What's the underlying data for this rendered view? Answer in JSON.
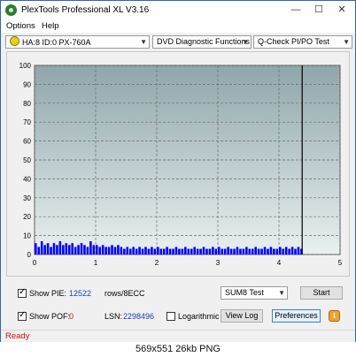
{
  "window": {
    "title": "PlexTools Professional XL V3.16",
    "minimize": "—",
    "maximize": "☐",
    "close": "✕"
  },
  "menu": {
    "options": "Options",
    "help": "Help"
  },
  "toolbar": {
    "drive": "HA:8 ID:0  PX-760A",
    "mode": "DVD Diagnostic Functions",
    "test": "Q-Check PI/PO Test"
  },
  "chart_data": {
    "type": "bar",
    "title": "",
    "xlabel": "",
    "ylabel": "",
    "xlim": [
      0,
      5
    ],
    "ylim": [
      0,
      100
    ],
    "x_ticks": [
      "0",
      "1",
      "2",
      "3",
      "4",
      "5"
    ],
    "y_ticks": [
      "0",
      "10",
      "20",
      "30",
      "40",
      "50",
      "60",
      "70",
      "80",
      "90",
      "100"
    ],
    "grid": true,
    "end_marker_x": 4.38,
    "series": [
      {
        "color": "#0000ff",
        "points": [
          [
            0.0,
            6
          ],
          [
            0.05,
            4
          ],
          [
            0.1,
            7
          ],
          [
            0.15,
            5
          ],
          [
            0.2,
            6
          ],
          [
            0.25,
            4
          ],
          [
            0.3,
            6
          ],
          [
            0.35,
            5
          ],
          [
            0.4,
            7
          ],
          [
            0.45,
            5
          ],
          [
            0.5,
            6
          ],
          [
            0.55,
            5
          ],
          [
            0.6,
            6
          ],
          [
            0.65,
            4
          ],
          [
            0.7,
            5
          ],
          [
            0.75,
            6
          ],
          [
            0.8,
            5
          ],
          [
            0.85,
            4
          ],
          [
            0.9,
            7
          ],
          [
            0.95,
            5
          ],
          [
            1.0,
            5
          ],
          [
            1.05,
            4
          ],
          [
            1.1,
            5
          ],
          [
            1.15,
            4
          ],
          [
            1.2,
            4
          ],
          [
            1.25,
            5
          ],
          [
            1.3,
            4
          ],
          [
            1.35,
            5
          ],
          [
            1.4,
            4
          ],
          [
            1.45,
            3
          ],
          [
            1.5,
            4
          ],
          [
            1.55,
            3
          ],
          [
            1.6,
            4
          ],
          [
            1.65,
            3
          ],
          [
            1.7,
            4
          ],
          [
            1.75,
            3
          ],
          [
            1.8,
            4
          ],
          [
            1.85,
            3
          ],
          [
            1.9,
            4
          ],
          [
            1.95,
            3
          ],
          [
            2.0,
            4
          ],
          [
            2.05,
            3
          ],
          [
            2.1,
            3
          ],
          [
            2.15,
            4
          ],
          [
            2.2,
            3
          ],
          [
            2.25,
            3
          ],
          [
            2.3,
            4
          ],
          [
            2.35,
            3
          ],
          [
            2.4,
            3
          ],
          [
            2.45,
            4
          ],
          [
            2.5,
            3
          ],
          [
            2.55,
            3
          ],
          [
            2.6,
            4
          ],
          [
            2.65,
            3
          ],
          [
            2.7,
            3
          ],
          [
            2.75,
            4
          ],
          [
            2.8,
            3
          ],
          [
            2.85,
            3
          ],
          [
            2.9,
            4
          ],
          [
            2.95,
            3
          ],
          [
            3.0,
            4
          ],
          [
            3.05,
            3
          ],
          [
            3.1,
            3
          ],
          [
            3.15,
            4
          ],
          [
            3.2,
            3
          ],
          [
            3.25,
            3
          ],
          [
            3.3,
            4
          ],
          [
            3.35,
            3
          ],
          [
            3.4,
            3
          ],
          [
            3.45,
            4
          ],
          [
            3.5,
            3
          ],
          [
            3.55,
            3
          ],
          [
            3.6,
            4
          ],
          [
            3.65,
            3
          ],
          [
            3.7,
            3
          ],
          [
            3.75,
            4
          ],
          [
            3.8,
            3
          ],
          [
            3.85,
            4
          ],
          [
            3.9,
            3
          ],
          [
            3.95,
            3
          ],
          [
            4.0,
            4
          ],
          [
            4.05,
            3
          ],
          [
            4.1,
            4
          ],
          [
            4.15,
            3
          ],
          [
            4.2,
            4
          ],
          [
            4.25,
            3
          ],
          [
            4.3,
            4
          ],
          [
            4.35,
            3
          ]
        ]
      }
    ]
  },
  "controls": {
    "show_pie_label": "Show PIE:",
    "pie_value": "12522",
    "pie_unit": "rows/8ECC",
    "show_pof_label": "Show POF:",
    "pof_value": "0",
    "lsn_label": "LSN:",
    "lsn_value": "2298496",
    "logarithmic_label": "Logarithmic",
    "test_select": "SUM8 Test",
    "start": "Start",
    "view_log": "View Log",
    "preferences": "Preferences",
    "info": "i"
  },
  "status": {
    "text": "Ready"
  },
  "caption": "569x551  26kb  PNG"
}
